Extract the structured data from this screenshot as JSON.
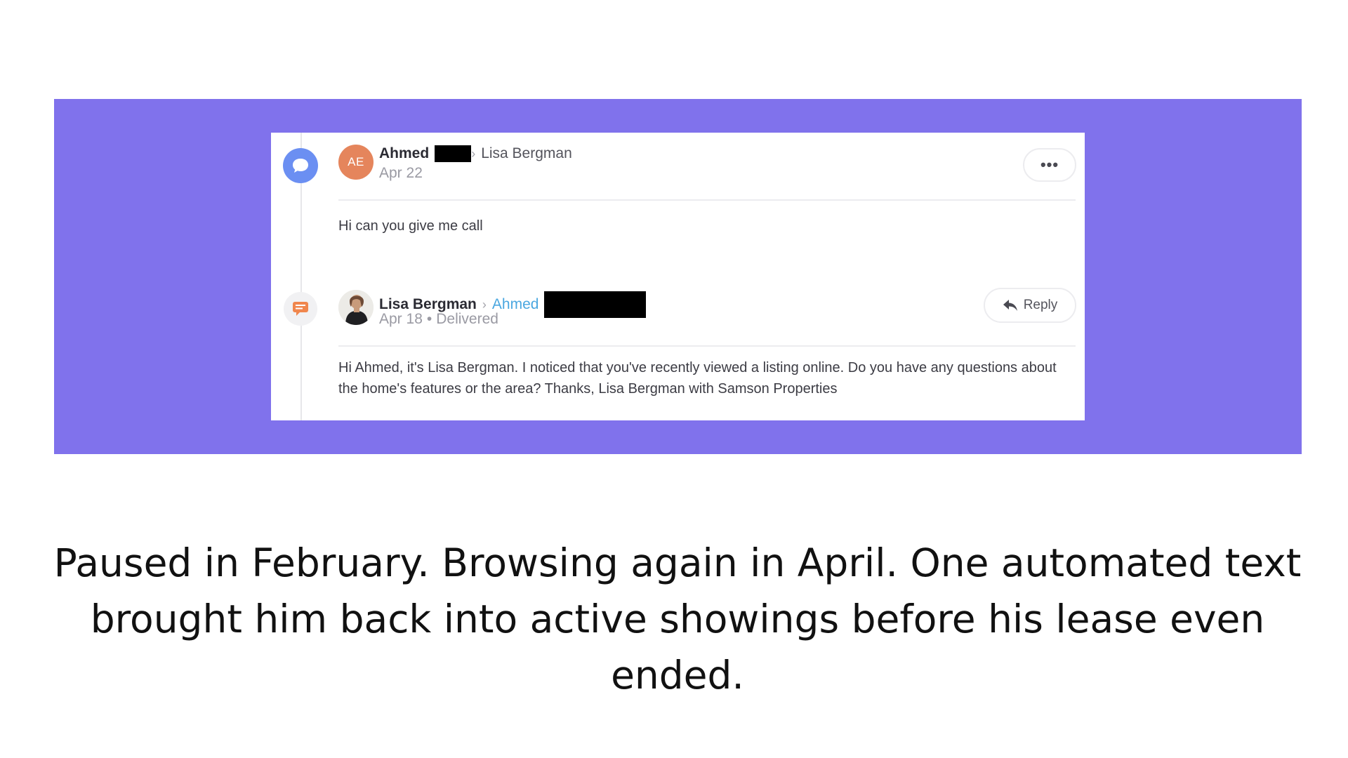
{
  "thread": {
    "incoming": {
      "avatar_initials": "AE",
      "sender": "Ahmed",
      "recipient": "Lisa Bergman",
      "date": "Apr 22",
      "body": "Hi can you give me call",
      "more_label": "•••"
    },
    "outgoing": {
      "sender": "Lisa Bergman",
      "recipient": "Ahmed",
      "date": "Apr 18",
      "status": "Delivered",
      "body": "Hi Ahmed, it's Lisa Bergman. I noticed that you've recently viewed a listing online. Do you have any questions about the home's features or the area? Thanks, Lisa Bergman with Samson Properties",
      "reply_label": "Reply"
    }
  },
  "caption": "Paused in February. Browsing again in April. One automated text brought him back into active showings before his lease even ended.",
  "colors": {
    "banner": "#8072ec",
    "incoming_icon": "#6b8ff2",
    "outgoing_icon": "#f0864d",
    "avatar_ae": "#e5855c",
    "link": "#4aa7e0"
  },
  "icons": {
    "incoming": "chat-bubble-icon",
    "outgoing": "sms-message-icon",
    "reply": "reply-arrow-icon",
    "sep": "chevron-right-icon"
  }
}
